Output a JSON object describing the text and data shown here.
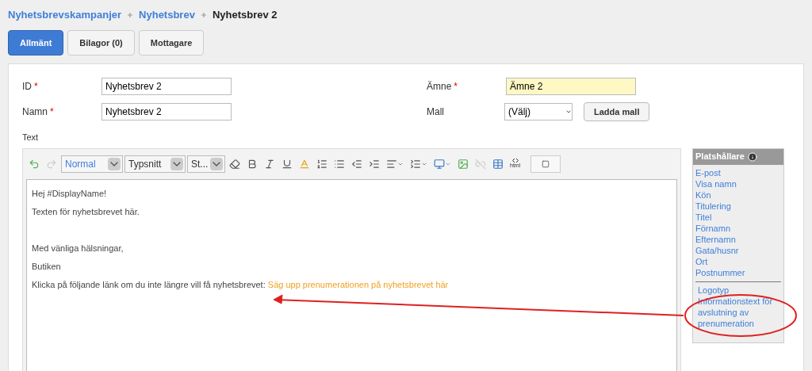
{
  "breadcrumb": [
    {
      "label": "Nyhetsbrevskampanjer",
      "current": false
    },
    {
      "label": "Nyhetsbrev",
      "current": false
    },
    {
      "label": "Nyhetsbrev 2",
      "current": true
    }
  ],
  "tabs": [
    {
      "label": "Allmänt",
      "selected": true
    },
    {
      "label": "Bilagor (0)",
      "selected": false
    },
    {
      "label": "Mottagare",
      "selected": false
    }
  ],
  "form": {
    "id": {
      "label": "ID",
      "required_mark": "*",
      "value": "Nyhetsbrev 2"
    },
    "name": {
      "label": "Namn",
      "required_mark": "*",
      "value": "Nyhetsbrev 2"
    },
    "subject": {
      "label": "Ämne",
      "required_mark": "*",
      "value": "Ämne 2",
      "highlighted": true
    },
    "template": {
      "label": "Mall",
      "value": "(Välj)",
      "button": "Ladda mall"
    },
    "text_label": "Text"
  },
  "toolbar": {
    "format": "Normal",
    "font": "Typsnitt",
    "size": "St...",
    "undo_disabled": false,
    "redo_disabled": true,
    "unlink_disabled": true,
    "html_label": "html"
  },
  "editor": {
    "blocks": [
      [
        {
          "text": "Hej #DisplayName!"
        },
        {
          "text": "Texten för nyhetsbrevet här."
        }
      ],
      [
        {
          "text": "Med vänliga hälsningar,"
        },
        {
          "text": "Butiken"
        },
        {
          "text": "Klicka på följande länk om du inte längre vill få nyhetsbrevet:",
          "link": "Säg upp prenumerationen på nyhetsbrevet här"
        }
      ]
    ]
  },
  "placeholders": {
    "title": "Platshållare",
    "groups": [
      [
        "E-post",
        "Visa namn",
        "Kön",
        "Titulering",
        "Titel",
        "Förnamn",
        "Efternamn",
        "Gata/husnr",
        "Ort",
        "Postnummer"
      ],
      [
        "Logotyp",
        "Informationstext för avslutning av prenumeration"
      ]
    ]
  }
}
